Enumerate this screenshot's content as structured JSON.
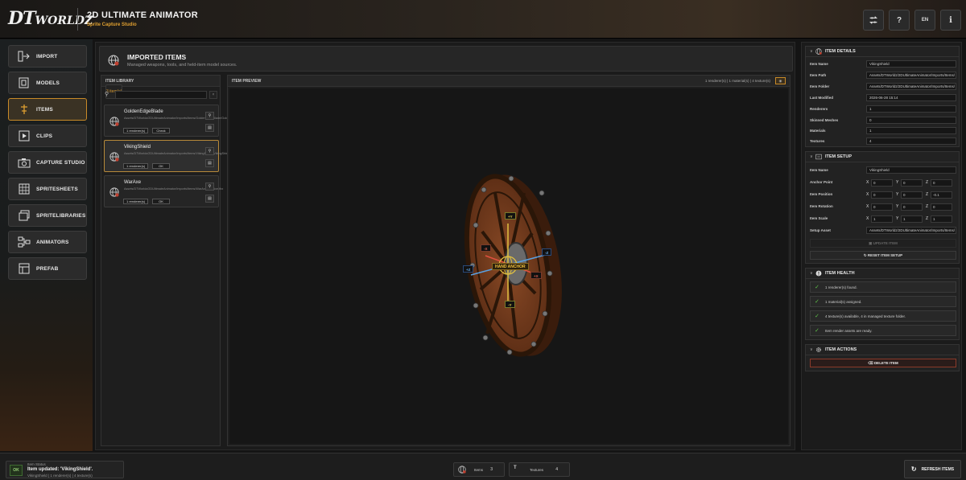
{
  "header": {
    "logo_text": "DTWORLDZ",
    "title": "2D ULTIMATE ANIMATOR",
    "subtitle": "Sprite Capture Studio",
    "buttons": [
      {
        "name": "swap-icon",
        "label": ""
      },
      {
        "name": "help-icon",
        "label": "?"
      },
      {
        "name": "language",
        "label": "EN"
      },
      {
        "name": "info-icon",
        "label": "i"
      }
    ]
  },
  "sidebar": {
    "items": [
      {
        "label": "IMPORT",
        "icon": "import-icon",
        "active": false
      },
      {
        "label": "MODELS",
        "icon": "models-icon",
        "active": false
      },
      {
        "label": "ITEMS",
        "icon": "items-icon",
        "active": true
      },
      {
        "label": "CLIPS",
        "icon": "clips-icon",
        "active": false
      },
      {
        "label": "CAPTURE STUDIO",
        "icon": "camera-icon",
        "active": false
      },
      {
        "label": "SPRITESHEETS",
        "icon": "grid-icon",
        "active": false
      },
      {
        "label": "SPRITELIBRARIES",
        "icon": "layers-icon",
        "active": false
      },
      {
        "label": "ANIMATORS",
        "icon": "nodes-icon",
        "active": false
      },
      {
        "label": "PREFAB",
        "icon": "prefab-icon",
        "active": false
      }
    ]
  },
  "main": {
    "title": "IMPORTED ITEMS",
    "subtitle": "Managed weapons, tools, and held-item model sources.",
    "library": {
      "header": "ITEM LIBRARY",
      "count": "3 item(s)",
      "search_placeholder": "",
      "clear_label": "×",
      "items": [
        {
          "name": "GoldenEdgeBlade",
          "path": "Assets/DTWorldz/2DUltimateAnimator/Imports/Items/GoldenEdgeBlade/GoldenEdgeBlade.fbx",
          "renderers": "1 renderer(s)",
          "status": "Check",
          "selected": false
        },
        {
          "name": "VikingShield",
          "path": "Assets/DTWorldz/2DUltimateAnimator/Imports/Items/VikingShield/VikingShield.fbx",
          "renderers": "1 renderer(s)",
          "status": "OK",
          "selected": true
        },
        {
          "name": "WarAxe",
          "path": "Assets/DTWorldz/2DUltimateAnimator/Imports/Items/WarAxe/WarAxe.fbx",
          "renderers": "1 renderer(s)",
          "status": "OK",
          "selected": false
        }
      ]
    },
    "preview": {
      "header": "ITEM PREVIEW",
      "stats": "1 renderer(s) | 1 material(s) | 4 texture(s)",
      "gizmo": {
        "pos_y": "+Y",
        "neg_y": "-Y",
        "pos_x": "+X",
        "neg_x": "-X",
        "pos_z": "+Z",
        "neg_z": "-Z",
        "anchor": "HAND ANCHOR"
      }
    }
  },
  "details": {
    "title": "ITEM DETAILS",
    "rows": [
      {
        "key": "Item Name",
        "value": "VikingShield"
      },
      {
        "key": "Item Path",
        "value": "Assets/DTWorldz/2DUltimateAnimator/Imports/Items/"
      },
      {
        "key": "Item Folder",
        "value": "Assets/DTWorldz/2DUltimateAnimator/Imports/Items/"
      },
      {
        "key": "Last Modified",
        "value": "2026-06-28 15:14"
      },
      {
        "key": "Renderers",
        "value": "1"
      },
      {
        "key": "Skinned Meshes",
        "value": "0"
      },
      {
        "key": "Materials",
        "value": "1"
      },
      {
        "key": "Textures",
        "value": "4"
      }
    ]
  },
  "setup": {
    "title": "ITEM SETUP",
    "item_name_label": "Item Name",
    "item_name": "VikingShield",
    "vectors": [
      {
        "key": "Anchor Point",
        "x": "0",
        "y": "0",
        "z": "0"
      },
      {
        "key": "Item Position",
        "x": "0",
        "y": "0",
        "z": "-0.1"
      },
      {
        "key": "Item Rotation",
        "x": "0",
        "y": "0",
        "z": "0"
      },
      {
        "key": "Item Scale",
        "x": "1",
        "y": "1",
        "z": "1"
      }
    ],
    "axis_x": "X",
    "axis_y": "Y",
    "axis_z": "Z",
    "setup_asset_label": "Setup Asset",
    "setup_asset": "Assets/DTWorldz/2DUltimateAnimator/Imports/Items/",
    "update_label": "UPDATE ITEM",
    "reset_label": "RESET ITEM SETUP"
  },
  "health": {
    "title": "ITEM HEALTH",
    "rows": [
      "1 renderer(s) found.",
      "1 material(s) assigned.",
      "4 texture(s) available, 4 in managed texture folder.",
      "Item render assets are ready."
    ]
  },
  "actions": {
    "title": "ITEM ACTIONS",
    "delete_label": "DELETE ITEM"
  },
  "footer": {
    "status_label": "Item Status",
    "ok": "OK",
    "message": "Item updated: 'VikingShield'.",
    "detail": "VikingShield | 1 renderer(s) | 4 texture(s)",
    "items_label": "Items",
    "items_count": "3",
    "textures_label": "Textures",
    "textures_count": "4",
    "refresh_label": "REFRESH ITEMS"
  },
  "colors": {
    "accent": "#d89a30",
    "active_border": "#c98a28",
    "ok_green": "#5fc34a",
    "danger": "#8a3a2a"
  }
}
